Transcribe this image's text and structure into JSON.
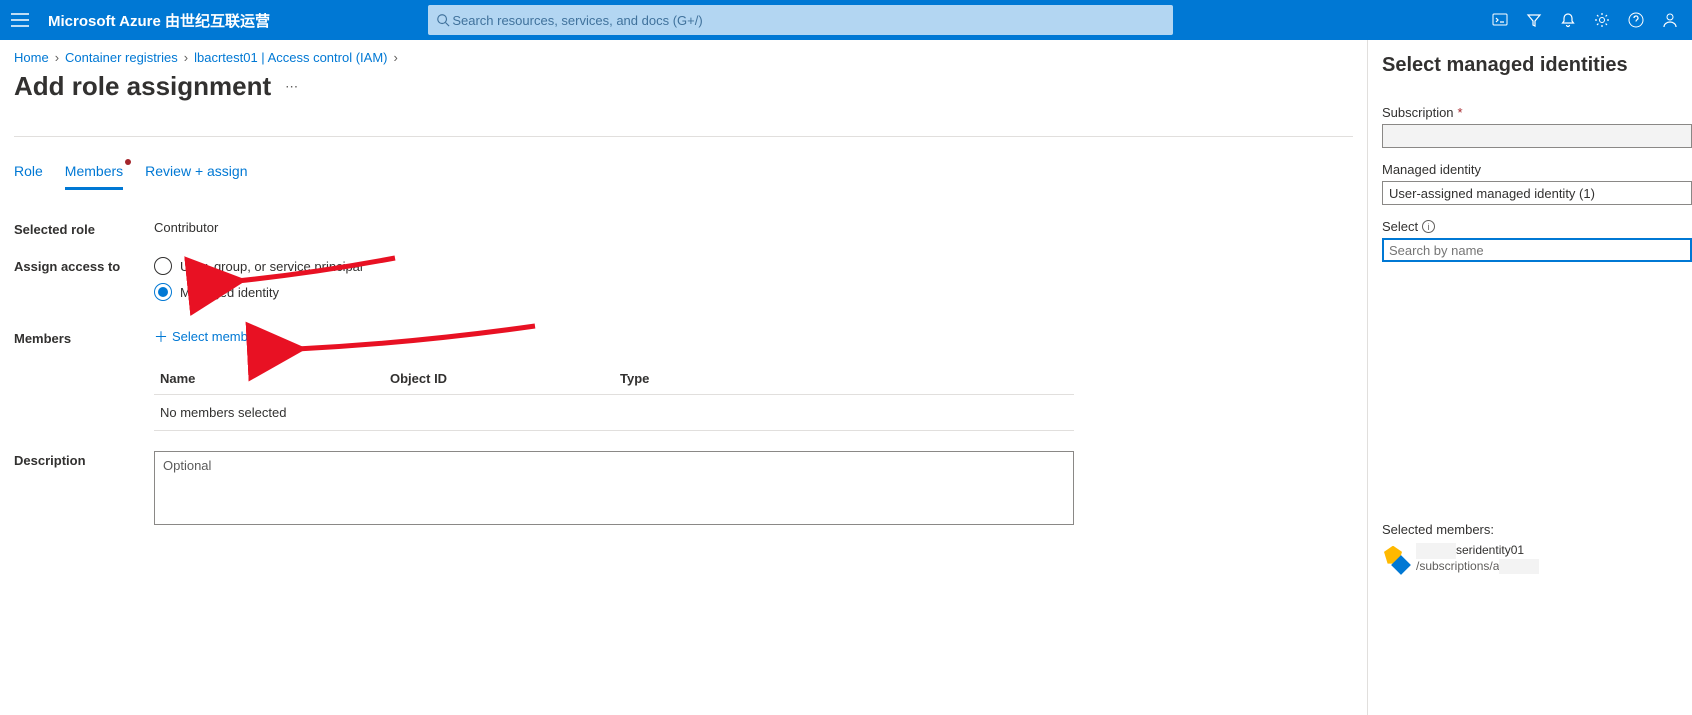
{
  "topbar": {
    "brand": "Microsoft Azure 由世纪互联运营",
    "search_placeholder": "Search resources, services, and docs (G+/)"
  },
  "breadcrumb": {
    "items": [
      "Home",
      "Container registries",
      "lbacrtest01 | Access control (IAM)"
    ]
  },
  "page": {
    "title": "Add role assignment"
  },
  "tabs": {
    "role": "Role",
    "members": "Members",
    "review": "Review + assign"
  },
  "form": {
    "selected_role_label": "Selected role",
    "selected_role_value": "Contributor",
    "assign_access_label": "Assign access to",
    "radio_user": "User, group, or service principal",
    "radio_mi": "Managed identity",
    "members_label": "Members",
    "select_members_link": "Select members",
    "table": {
      "col_name": "Name",
      "col_object": "Object ID",
      "col_type": "Type",
      "empty": "No members selected"
    },
    "description_label": "Description",
    "description_placeholder": "Optional"
  },
  "side": {
    "title": "Select managed identities",
    "subscription_label": "Subscription",
    "subscription_value": " ",
    "mi_label": "Managed identity",
    "mi_value": "User-assigned managed identity (1)",
    "select_label": "Select",
    "select_placeholder": "Search by name",
    "selected_members_label": "Selected members:",
    "member": {
      "name_suffix": "seridentity01",
      "sub": "/subscriptions/a"
    }
  }
}
